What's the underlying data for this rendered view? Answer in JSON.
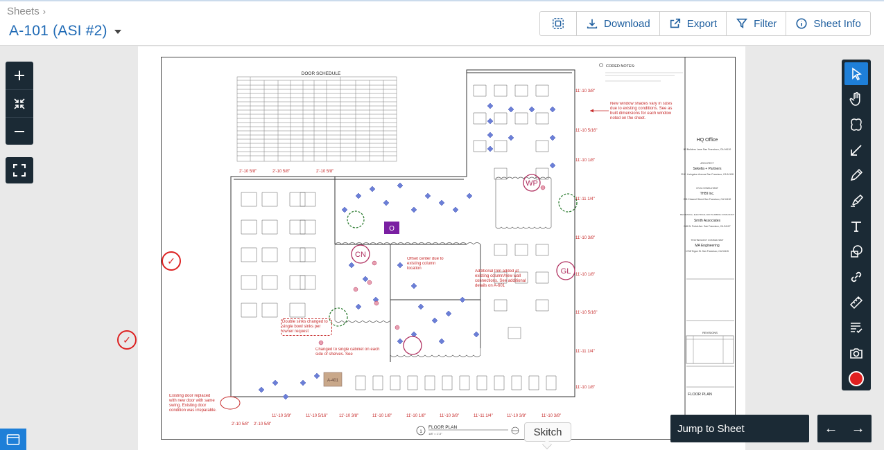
{
  "header": {
    "breadcrumb": "Sheets",
    "sheet_title": "A-101 (ASI #2)",
    "toolbar": {
      "download_label": "Download",
      "export_label": "Export",
      "filter_label": "Filter",
      "sheet_info_label": "Sheet Info"
    }
  },
  "drawing": {
    "door_schedule_title": "DOOR SCHEDULE",
    "coded_notes_title": "CODED NOTES:",
    "note_window_shades": "New window shades vary in sizes due to existing conditions. See as built dimensions for each window noted on the sheet.",
    "note_offset_center": "Offset center due to existing column location",
    "note_additional_trim": "Additional trim added at existing column/new wall connections. See additional details on A-601",
    "note_double_sinks": "Double sinks changed to single bowl sinks per owner request",
    "note_single_cabinet": "Changed to single cabinet on each side of shelves. See",
    "note_existing_door": "Existing door replaced with new door with same swing. Existing door condition was irreparable.",
    "stamp_wp": "WP",
    "stamp_cn": "CN",
    "stamp_gl": "GL",
    "stamp_o": "O",
    "tag_a401": "A-401",
    "plan_label": "FLOOR PLAN",
    "plan_scale": "1/8\" = 1'-0\"",
    "plan_number": "1",
    "top_dims": [
      "2'-10 5/8\"",
      "2'-10 5/8\"",
      "2'-10 5/8\""
    ],
    "right_dims": [
      "11'-10 3/8\"",
      "11'-10 5/16\"",
      "11'-10 1/8\"",
      "11'-11 1/4\"",
      "11'-10 3/8\"",
      "11'-10 1/8\"",
      "11'-10 5/16\"",
      "11'-11 1/4\"",
      "11'-10 3/8\"",
      "11'-10 1/8\""
    ],
    "bottom_dims": [
      "2'-10 5/8\"",
      "2'-10 5/8\"",
      "11'-10 3/8\"",
      "11'-10 5/16\"",
      "11'-10 3/8\"",
      "11'-10 1/8\"",
      "11'-10 1/8\"",
      "11'-10 3/8\"",
      "11'-11 1/4\"",
      "11'-10 3/8\"",
      "11'-10 3/8\""
    ],
    "title_block": {
      "project": "HQ Office",
      "project_address": "88 Builders Lane San Francisco, CA 94110",
      "architect_label": "ARCHITECT",
      "architect": "Sekella + Partners",
      "architect_address": "25 E. Livingston Avenue San Francisco, CA 94108",
      "civil_label": "CIVIL CONSULTANT",
      "civil": "THBI Inc.",
      "civil_address": "295 Channel Street San Francisco, CA 94130",
      "mep_label": "MECHANICAL, ELECTRICAL AND PLUMBING CONSULTANT",
      "mep": "Smith Associates",
      "mep_address": "848 W. Portal Ave. San Francisco, CA 94127",
      "tech_label": "TECHNOLOGY CONSULTANT",
      "tech": "MA Engineering",
      "tech_address": "1768 Tegan St. San Francisco, CA 94115",
      "revisions_label": "REVISIONS",
      "sheet_name": "FLOOR PLAN"
    }
  },
  "bottom": {
    "jump_label": "Jump to Sheet",
    "skitch_label": "Skitch"
  },
  "colors": {
    "accent": "#1f6ab5",
    "dark_panel": "#1b2a35",
    "active_tool": "#1e7fd8",
    "markup_red": "#d22",
    "markup_green": "#2e7d32",
    "markup_magenta": "#b03060",
    "markup_purple": "#7a1fa2"
  }
}
